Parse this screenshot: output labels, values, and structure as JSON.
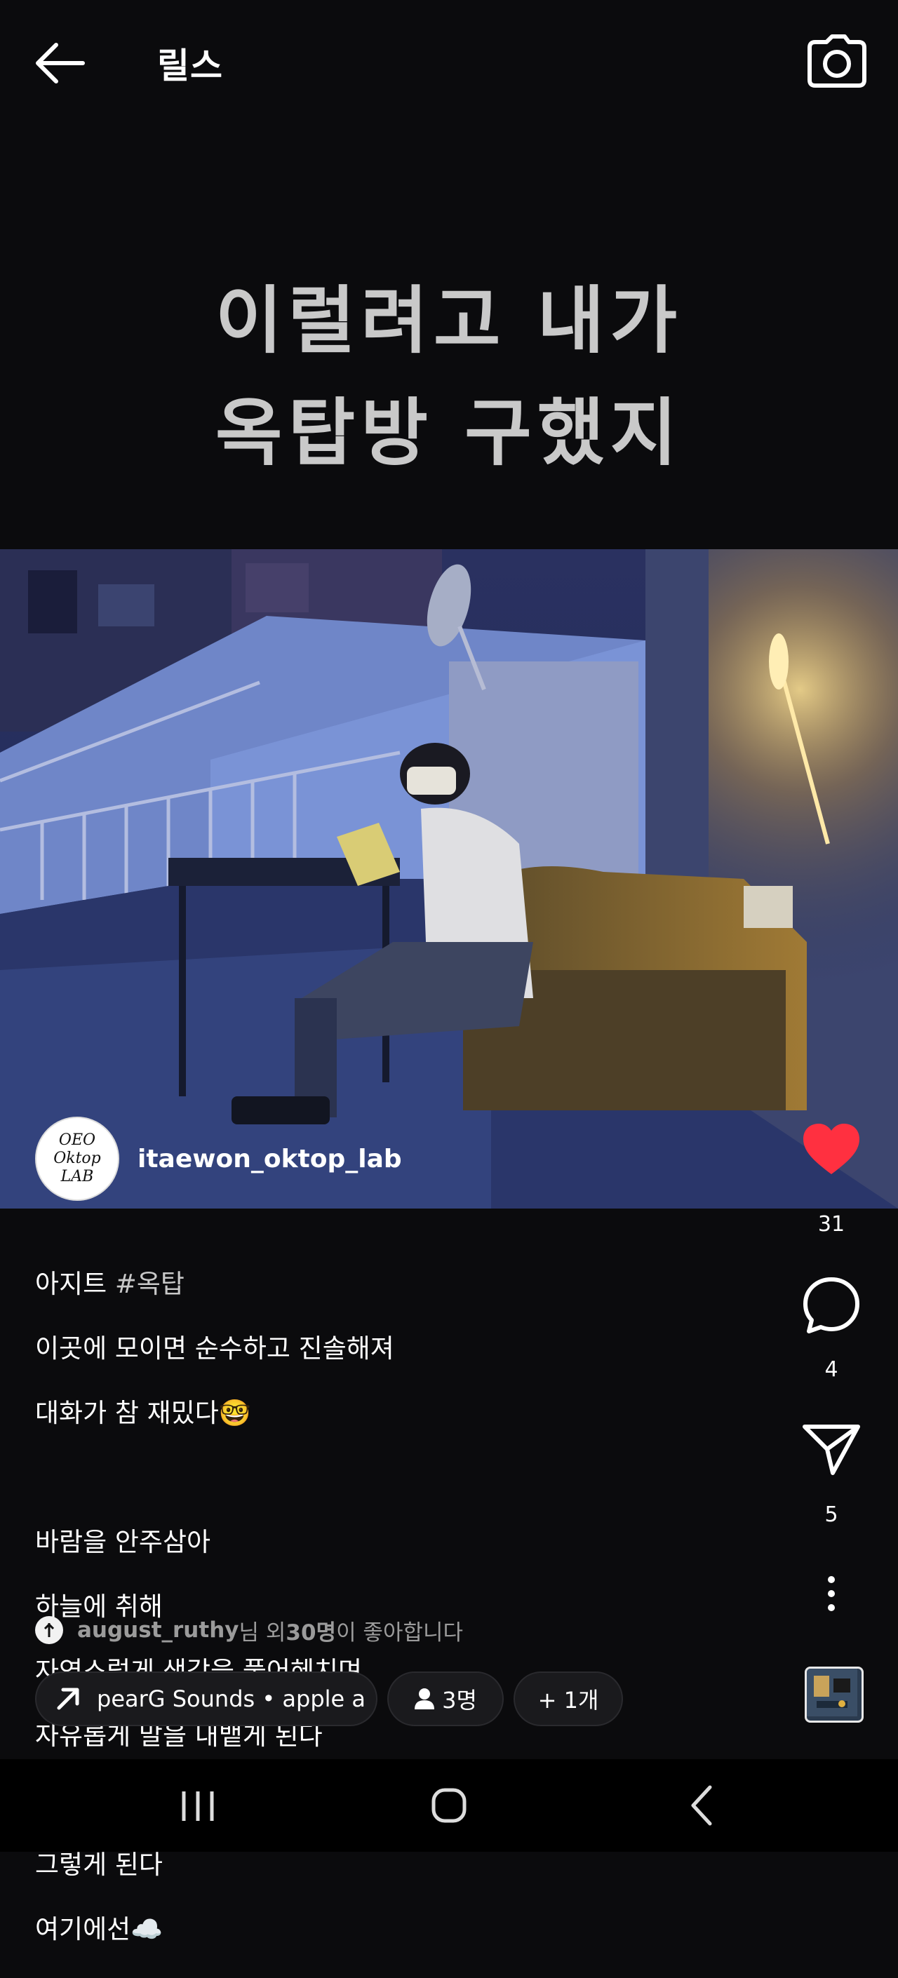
{
  "header": {
    "title": "릴스",
    "back_icon": "arrow-left-icon",
    "camera_icon": "camera-icon"
  },
  "video": {
    "overlay_line1": "이럴려고 내가",
    "overlay_line2": "옥탑방 구했지"
  },
  "author": {
    "username": "itaewon_oktop_lab",
    "avatar_text": "OEO Oktop LAB"
  },
  "actions": {
    "likes": "31",
    "comments": "4",
    "shares": "5",
    "like_color": "#ff3040"
  },
  "caption": {
    "line1_prefix": "아지트 ",
    "line1_hashtag": "#옥탑",
    "line2": "이곳에 모이면 순수하고 진솔해져",
    "line3": "대화가 참 재밌다🤓",
    "line4": "바람을 안주삼아",
    "line5": "하늘에 취해",
    "line6": "자연스럽게 생각을 풀어헤치며",
    "line7": "자유롭게 말을 내뱉게 된다",
    "line8": "그렇게 된다",
    "line9": "여기에선☁️"
  },
  "liked_by": {
    "user": "august_ruthy",
    "suffix1": "님 외 ",
    "count": "30명",
    "suffix2": "이 좋아합니다"
  },
  "chips": {
    "music_left": "pear",
    "music_right": "G Sounds • apple a",
    "people": "3명",
    "more": "+ 1개"
  },
  "system_nav": {
    "recents_icon": "recents-icon",
    "home_icon": "home-icon",
    "back_icon": "back-chevron-icon"
  }
}
